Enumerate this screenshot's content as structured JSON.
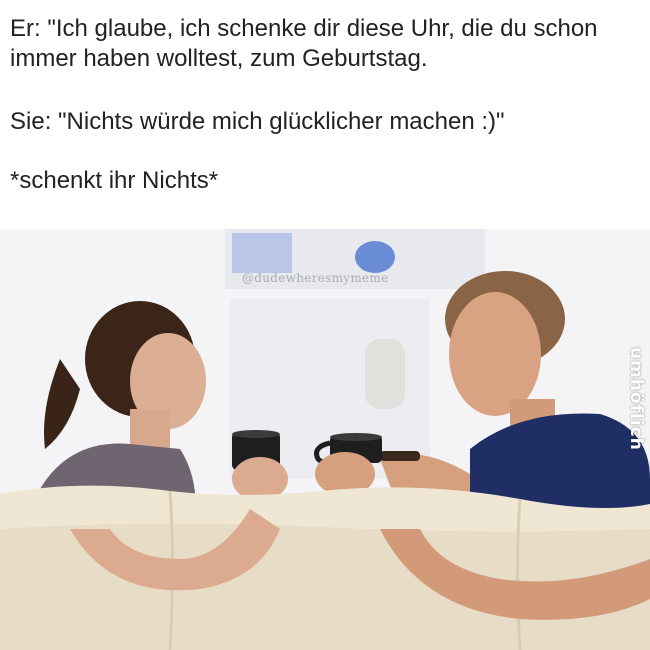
{
  "caption": {
    "line_1": "Er: \"Ich glaube, ich schenke dir diese Uhr, die du schon immer haben wolltest, zum Geburtstag.",
    "line_2": "Sie: \"Nichts würde mich glücklicher machen :)\"",
    "line_3": "*schenkt ihr Nichts*"
  },
  "photo": {
    "watermark": "@dudewheresmymeme",
    "logo": "umhöflich"
  },
  "colors": {
    "background": "#ffffff",
    "text": "#222222",
    "shirt": "#1f2f66",
    "sofa": "#efe6d3",
    "mug": "#1e1e1e"
  }
}
